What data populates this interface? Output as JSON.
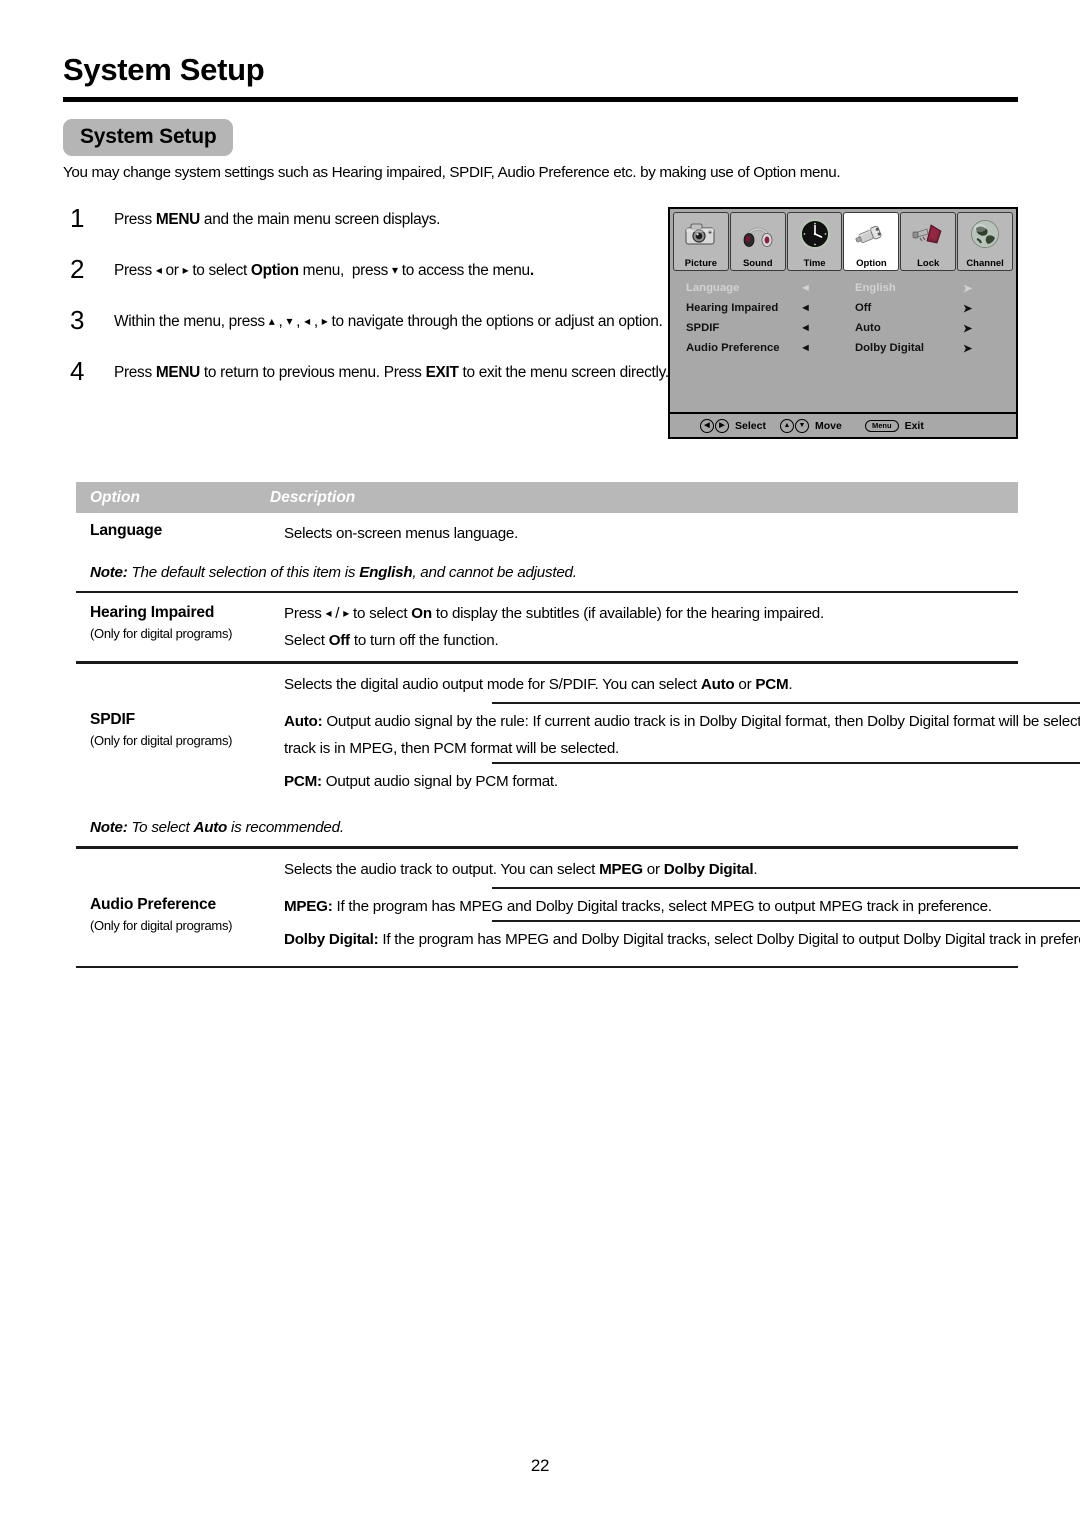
{
  "header": {
    "title": "System Setup",
    "section_pill": "System Setup"
  },
  "intro": "You may change system settings such as Hearing impaired, SPDIF, Audio Preference etc. by making use of Option menu.",
  "steps": [
    {
      "num": "1",
      "text_html": "Press <b>MENU</b> and the main menu screen displays."
    },
    {
      "num": "2",
      "text_html": "Press <span class=\"arrow\">&#9666;</span> or <span class=\"arrow\">&#9656;</span> to select <b>Option</b> menu,&nbsp; press <span class=\"arrow\">&#9662;</span> to access the menu<b>.</b>"
    },
    {
      "num": "3",
      "text_html": "Within the menu, press <span class=\"arrow\">&#9652;</span> , <span class=\"arrow\">&#9662;</span> , <span class=\"arrow\">&#9666;</span> , <span class=\"arrow\">&#9656;</span> to navigate through the options or adjust an option."
    },
    {
      "num": "4",
      "text_html": "Press <b>MENU</b> to return to previous menu. Press <b>EXIT</b> to exit the menu screen directly."
    }
  ],
  "osd": {
    "icons": [
      {
        "label": "Picture",
        "icon": "camera-icon",
        "active": false
      },
      {
        "label": "Sound",
        "icon": "headphones-icon",
        "active": false
      },
      {
        "label": "Time",
        "icon": "clock-icon",
        "active": false
      },
      {
        "label": "Option",
        "icon": "plug-connector-icon",
        "active": true
      },
      {
        "label": "Lock",
        "icon": "padlock-key-icon",
        "active": false
      },
      {
        "label": "Channel",
        "icon": "globe-icon",
        "active": false
      }
    ],
    "rows": [
      {
        "label": "Language",
        "value": "English",
        "left_arrow": "◄",
        "right_arrow": "➤",
        "disabled": true
      },
      {
        "label": "Hearing Impaired",
        "value": "Off",
        "left_arrow": "◄",
        "right_arrow": "➤",
        "disabled": false
      },
      {
        "label": "SPDIF",
        "value": "Auto",
        "left_arrow": "◄",
        "right_arrow": "➤",
        "disabled": false
      },
      {
        "label": "Audio Preference",
        "value": "Dolby Digital",
        "left_arrow": "◄",
        "right_arrow": "➤",
        "disabled": false
      }
    ],
    "footer": [
      {
        "icons": [
          "◀",
          "▶"
        ],
        "label": "Select",
        "type": "circles"
      },
      {
        "icons": [
          "▲",
          "▼"
        ],
        "label": "Move",
        "type": "circles"
      },
      {
        "icons": [
          "Menu"
        ],
        "label": "Exit",
        "type": "pill"
      }
    ],
    "colors": {
      "panel_bg": "#a8a8a8",
      "icon_bg": "#b9b9b9",
      "icon_active_bg": "#ffffff",
      "disabled_text": "#d2d2d2"
    }
  },
  "table": {
    "headers": {
      "option": "Option",
      "description": "Description"
    },
    "header_bg": "#b8b8b8",
    "rows": [
      {
        "option": "Language",
        "sub": "",
        "desc_blocks": [
          {
            "html": "Selects on-screen menus language."
          }
        ]
      },
      {
        "note_html": "<span class=\"nb\">Note:</span> The default selection of this item is <b>English</b>, and cannot be adjusted."
      },
      {
        "option": "Hearing Impaired",
        "sub": "(Only for digital programs)",
        "desc_blocks": [
          {
            "html": "Press <span class=\"arrow\">&#9666;</span> / <span class=\"arrow\">&#9656;</span> to select <b>On</b> to display the subtitles (if available) for the hearing impaired."
          },
          {
            "html": "Select <b>Off</b> to turn off the function."
          }
        ]
      },
      {
        "option": "SPDIF",
        "sub": "(Only for digital programs)",
        "desc_blocks": [
          {
            "html": "Selects the digital audio output mode for S/PDIF. You can select <b>Auto</b> or <b>PCM</b>."
          },
          {
            "html": "<b>Auto:</b> Output audio signal by the rule: If current audio track is in Dolby Digital format, then Dolby Digital format will be selected. If current audio track is in MPEG, then PCM format will be selected."
          },
          {
            "html": "<b>PCM:</b> Output audio signal by PCM format."
          }
        ]
      },
      {
        "note_html": "<span class=\"nb\">Note:</span> To select <b>Auto</b> is recommended."
      },
      {
        "option": "Audio Preference",
        "sub": "(Only for digital programs)",
        "desc_blocks": [
          {
            "html": "Selects the audio track to output. You can select <b>MPEG</b> or <b>Dolby Digital</b>."
          },
          {
            "html": "<b>MPEG:</b> If the program has MPEG and Dolby Digital tracks, select MPEG to output MPEG track in preference."
          },
          {
            "html": "<b>Dolby Digital:</b> If the program has MPEG and Dolby Digital tracks, select Dolby Digital to output Dolby Digital track in preference."
          }
        ]
      }
    ]
  },
  "page_number": "22"
}
